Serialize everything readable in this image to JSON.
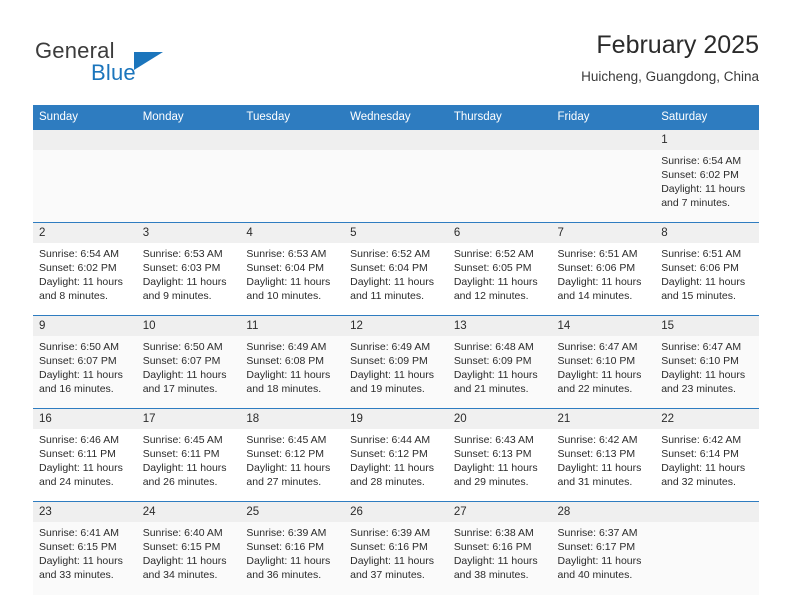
{
  "brand": {
    "name_part1": "General",
    "name_part2": "Blue",
    "triangle_icon": "brand-triangle-icon",
    "accent_color": "#1b75bc"
  },
  "header": {
    "title": "February 2025",
    "location": "Huicheng, Guangdong, China"
  },
  "calendar": {
    "header_bg": "#2e7cc0",
    "weekday_headers": [
      "Sunday",
      "Monday",
      "Tuesday",
      "Wednesday",
      "Thursday",
      "Friday",
      "Saturday"
    ],
    "labels": {
      "sunrise": "Sunrise:",
      "sunset": "Sunset:",
      "daylight": "Daylight:"
    },
    "weeks": [
      [
        {
          "day": "",
          "blank": true
        },
        {
          "day": "",
          "blank": true
        },
        {
          "day": "",
          "blank": true
        },
        {
          "day": "",
          "blank": true
        },
        {
          "day": "",
          "blank": true
        },
        {
          "day": "",
          "blank": true
        },
        {
          "day": "1",
          "sunrise": "Sunrise: 6:54 AM",
          "sunset": "Sunset: 6:02 PM",
          "daylight_line1": "Daylight: 11 hours",
          "daylight_line2": "and 7 minutes."
        }
      ],
      [
        {
          "day": "2",
          "sunrise": "Sunrise: 6:54 AM",
          "sunset": "Sunset: 6:02 PM",
          "daylight_line1": "Daylight: 11 hours",
          "daylight_line2": "and 8 minutes."
        },
        {
          "day": "3",
          "sunrise": "Sunrise: 6:53 AM",
          "sunset": "Sunset: 6:03 PM",
          "daylight_line1": "Daylight: 11 hours",
          "daylight_line2": "and 9 minutes."
        },
        {
          "day": "4",
          "sunrise": "Sunrise: 6:53 AM",
          "sunset": "Sunset: 6:04 PM",
          "daylight_line1": "Daylight: 11 hours",
          "daylight_line2": "and 10 minutes."
        },
        {
          "day": "5",
          "sunrise": "Sunrise: 6:52 AM",
          "sunset": "Sunset: 6:04 PM",
          "daylight_line1": "Daylight: 11 hours",
          "daylight_line2": "and 11 minutes."
        },
        {
          "day": "6",
          "sunrise": "Sunrise: 6:52 AM",
          "sunset": "Sunset: 6:05 PM",
          "daylight_line1": "Daylight: 11 hours",
          "daylight_line2": "and 12 minutes."
        },
        {
          "day": "7",
          "sunrise": "Sunrise: 6:51 AM",
          "sunset": "Sunset: 6:06 PM",
          "daylight_line1": "Daylight: 11 hours",
          "daylight_line2": "and 14 minutes."
        },
        {
          "day": "8",
          "sunrise": "Sunrise: 6:51 AM",
          "sunset": "Sunset: 6:06 PM",
          "daylight_line1": "Daylight: 11 hours",
          "daylight_line2": "and 15 minutes."
        }
      ],
      [
        {
          "day": "9",
          "sunrise": "Sunrise: 6:50 AM",
          "sunset": "Sunset: 6:07 PM",
          "daylight_line1": "Daylight: 11 hours",
          "daylight_line2": "and 16 minutes."
        },
        {
          "day": "10",
          "sunrise": "Sunrise: 6:50 AM",
          "sunset": "Sunset: 6:07 PM",
          "daylight_line1": "Daylight: 11 hours",
          "daylight_line2": "and 17 minutes."
        },
        {
          "day": "11",
          "sunrise": "Sunrise: 6:49 AM",
          "sunset": "Sunset: 6:08 PM",
          "daylight_line1": "Daylight: 11 hours",
          "daylight_line2": "and 18 minutes."
        },
        {
          "day": "12",
          "sunrise": "Sunrise: 6:49 AM",
          "sunset": "Sunset: 6:09 PM",
          "daylight_line1": "Daylight: 11 hours",
          "daylight_line2": "and 19 minutes."
        },
        {
          "day": "13",
          "sunrise": "Sunrise: 6:48 AM",
          "sunset": "Sunset: 6:09 PM",
          "daylight_line1": "Daylight: 11 hours",
          "daylight_line2": "and 21 minutes."
        },
        {
          "day": "14",
          "sunrise": "Sunrise: 6:47 AM",
          "sunset": "Sunset: 6:10 PM",
          "daylight_line1": "Daylight: 11 hours",
          "daylight_line2": "and 22 minutes."
        },
        {
          "day": "15",
          "sunrise": "Sunrise: 6:47 AM",
          "sunset": "Sunset: 6:10 PM",
          "daylight_line1": "Daylight: 11 hours",
          "daylight_line2": "and 23 minutes."
        }
      ],
      [
        {
          "day": "16",
          "sunrise": "Sunrise: 6:46 AM",
          "sunset": "Sunset: 6:11 PM",
          "daylight_line1": "Daylight: 11 hours",
          "daylight_line2": "and 24 minutes."
        },
        {
          "day": "17",
          "sunrise": "Sunrise: 6:45 AM",
          "sunset": "Sunset: 6:11 PM",
          "daylight_line1": "Daylight: 11 hours",
          "daylight_line2": "and 26 minutes."
        },
        {
          "day": "18",
          "sunrise": "Sunrise: 6:45 AM",
          "sunset": "Sunset: 6:12 PM",
          "daylight_line1": "Daylight: 11 hours",
          "daylight_line2": "and 27 minutes."
        },
        {
          "day": "19",
          "sunrise": "Sunrise: 6:44 AM",
          "sunset": "Sunset: 6:12 PM",
          "daylight_line1": "Daylight: 11 hours",
          "daylight_line2": "and 28 minutes."
        },
        {
          "day": "20",
          "sunrise": "Sunrise: 6:43 AM",
          "sunset": "Sunset: 6:13 PM",
          "daylight_line1": "Daylight: 11 hours",
          "daylight_line2": "and 29 minutes."
        },
        {
          "day": "21",
          "sunrise": "Sunrise: 6:42 AM",
          "sunset": "Sunset: 6:13 PM",
          "daylight_line1": "Daylight: 11 hours",
          "daylight_line2": "and 31 minutes."
        },
        {
          "day": "22",
          "sunrise": "Sunrise: 6:42 AM",
          "sunset": "Sunset: 6:14 PM",
          "daylight_line1": "Daylight: 11 hours",
          "daylight_line2": "and 32 minutes."
        }
      ],
      [
        {
          "day": "23",
          "sunrise": "Sunrise: 6:41 AM",
          "sunset": "Sunset: 6:15 PM",
          "daylight_line1": "Daylight: 11 hours",
          "daylight_line2": "and 33 minutes."
        },
        {
          "day": "24",
          "sunrise": "Sunrise: 6:40 AM",
          "sunset": "Sunset: 6:15 PM",
          "daylight_line1": "Daylight: 11 hours",
          "daylight_line2": "and 34 minutes."
        },
        {
          "day": "25",
          "sunrise": "Sunrise: 6:39 AM",
          "sunset": "Sunset: 6:16 PM",
          "daylight_line1": "Daylight: 11 hours",
          "daylight_line2": "and 36 minutes."
        },
        {
          "day": "26",
          "sunrise": "Sunrise: 6:39 AM",
          "sunset": "Sunset: 6:16 PM",
          "daylight_line1": "Daylight: 11 hours",
          "daylight_line2": "and 37 minutes."
        },
        {
          "day": "27",
          "sunrise": "Sunrise: 6:38 AM",
          "sunset": "Sunset: 6:16 PM",
          "daylight_line1": "Daylight: 11 hours",
          "daylight_line2": "and 38 minutes."
        },
        {
          "day": "28",
          "sunrise": "Sunrise: 6:37 AM",
          "sunset": "Sunset: 6:17 PM",
          "daylight_line1": "Daylight: 11 hours",
          "daylight_line2": "and 40 minutes."
        },
        {
          "day": "",
          "blank": true
        }
      ]
    ]
  }
}
